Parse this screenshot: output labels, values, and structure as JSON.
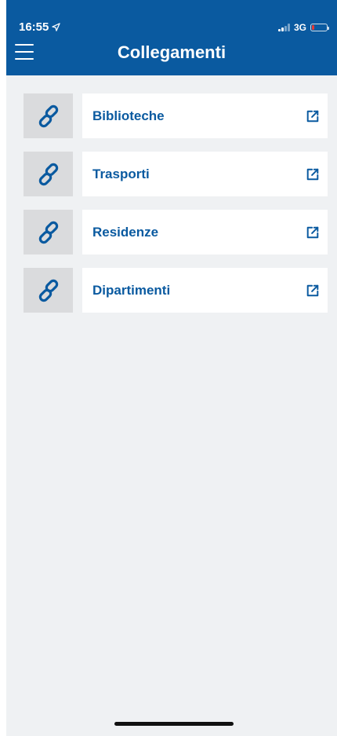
{
  "status_bar": {
    "time": "16:55",
    "network": "3G",
    "location_icon": "location-arrow-icon",
    "battery_icon": "battery-low-icon"
  },
  "header": {
    "title": "Collegamenti",
    "menu_icon": "hamburger-menu-icon"
  },
  "links": [
    {
      "label": "Biblioteche",
      "icon": "link-icon",
      "action_icon": "external-link-icon"
    },
    {
      "label": "Trasporti",
      "icon": "link-icon",
      "action_icon": "external-link-icon"
    },
    {
      "label": "Residenze",
      "icon": "link-icon",
      "action_icon": "external-link-icon"
    },
    {
      "label": "Dipartimenti",
      "icon": "link-icon",
      "action_icon": "external-link-icon"
    }
  ],
  "colors": {
    "primary": "#0a5aa0",
    "background": "#eff1f3",
    "icon_tile": "#dadbdd",
    "battery_low": "#e53935"
  }
}
